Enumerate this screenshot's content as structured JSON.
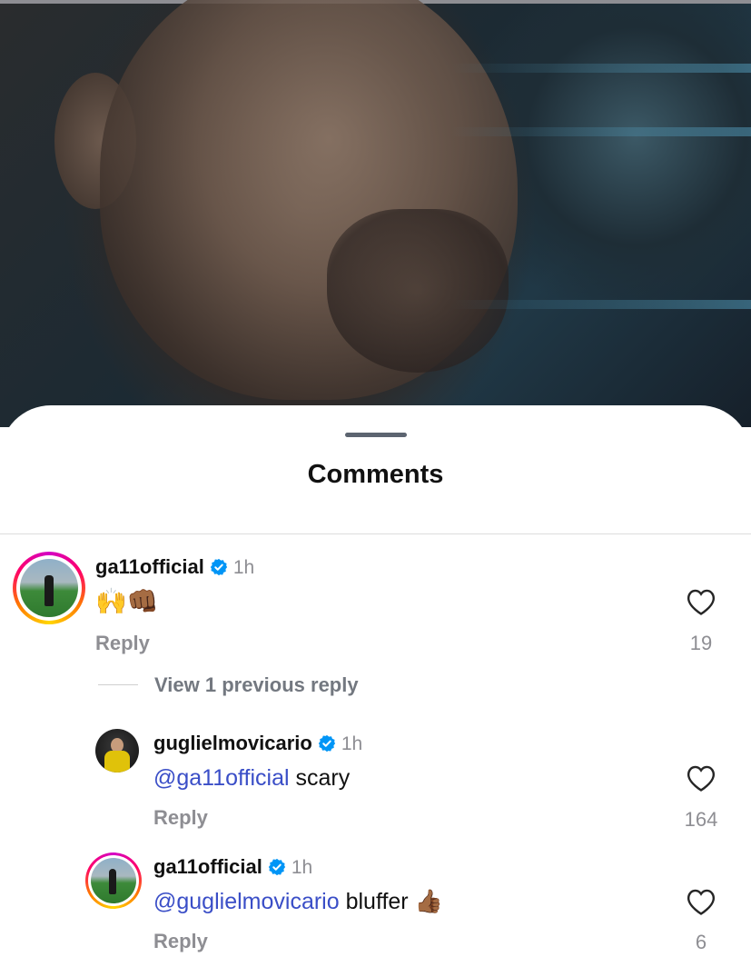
{
  "sheet": {
    "title": "Comments"
  },
  "comments": [
    {
      "username": "ga11official",
      "verified": true,
      "time": "1h",
      "text": "🙌👊🏾",
      "reply_label": "Reply",
      "likes": "19"
    }
  ],
  "thread": {
    "view_previous": "View 1 previous reply",
    "replies": [
      {
        "username": "guglielmovicario",
        "verified": true,
        "time": "1h",
        "mention": "@ga11official",
        "text": " scary",
        "reply_label": "Reply",
        "likes": "164"
      },
      {
        "username": "ga11official",
        "verified": true,
        "time": "1h",
        "mention": "@guglielmovicario",
        "text": " bluffer 👍🏾",
        "reply_label": "Reply",
        "likes": "6"
      }
    ]
  },
  "icons": {
    "verified": "verified-badge-icon",
    "like": "heart-icon"
  },
  "colors": {
    "mention": "#3a4ec7",
    "verified": "#0095f6",
    "muted": "#8e8e93"
  }
}
